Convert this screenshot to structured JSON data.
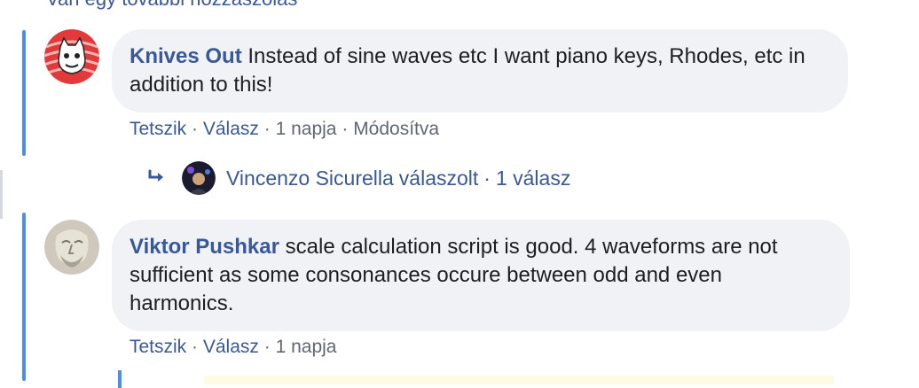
{
  "more_comments_link": "Van egy további hozzászólás",
  "comments": [
    {
      "author": "Knives Out",
      "text": "Instead of sine waves etc I want piano keys, Rhodes, etc in addition to this!",
      "actions": {
        "like": "Tetszik",
        "reply": "Válasz",
        "time": "1 napja",
        "edited": "Módosítva"
      }
    },
    {
      "author": "Viktor Pushkar",
      "text": "scale calculation script is good. 4 waveforms are not sufficient as some consonances occure between odd and even harmonics.",
      "actions": {
        "like": "Tetszik",
        "reply": "Válasz",
        "time": "1 napja"
      }
    }
  ],
  "reply_summary": {
    "author": "Vincenzo Sicurella",
    "verb": "válaszolt",
    "count": "1 válasz"
  },
  "separator": "·",
  "colors": {
    "link": "#385898",
    "thread_line": "#4a8fe7",
    "bubble": "#f0f2f5"
  }
}
